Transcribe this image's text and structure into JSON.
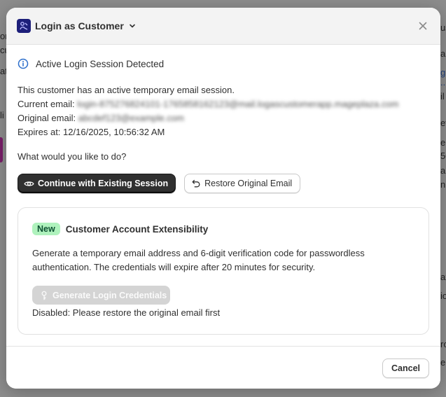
{
  "background": {
    "fragments_left": [
      "or",
      "cu",
      "at",
      "li"
    ],
    "fragments_right": [
      "us",
      "a",
      "g",
      "..",
      "il",
      "ef",
      "el",
      "50",
      "ar",
      "ni",
      "ax",
      "io",
      "ro",
      "er"
    ]
  },
  "modal": {
    "title": "Login as Customer",
    "app_logo_icon": "app-logo-icon",
    "close_icon": "close-icon",
    "banner": {
      "icon": "info-circle-icon",
      "text": "Active Login Session Detected"
    },
    "info": {
      "intro": "This customer has an active temporary email session.",
      "current_email_label": "Current email:",
      "current_email_value": "login-875276824101-1765858162123@mail.logascustomerapp.mageplaza.com",
      "original_email_label": "Original email:",
      "original_email_value": "abcdef123@example.com",
      "expires_label": "Expires at:",
      "expires_value": "12/16/2025, 10:56:32 AM"
    },
    "question": "What would you like to do?",
    "actions": {
      "continue_label": "Continue with Existing Session",
      "continue_icon": "eye-icon",
      "restore_label": "Restore Original Email",
      "restore_icon": "undo-icon"
    },
    "card": {
      "badge": "New",
      "title": "Customer Account Extensibility",
      "description": "Generate a temporary email address and 6-digit verification code for passwordless authentication. The credentials will expire after 20 minutes for security.",
      "generate_label": "Generate Login Credentials",
      "generate_icon": "key-icon",
      "disabled_note": "Disabled: Please restore the original email first"
    },
    "footer": {
      "cancel_label": "Cancel"
    }
  },
  "colors": {
    "primary_button": "#303030",
    "badge_bg": "#aff2bd",
    "badge_text": "#0c5132",
    "info_icon": "#2c6ecb",
    "app_logo": "#1d1f7a",
    "disabled_button": "#d4d4d4"
  }
}
